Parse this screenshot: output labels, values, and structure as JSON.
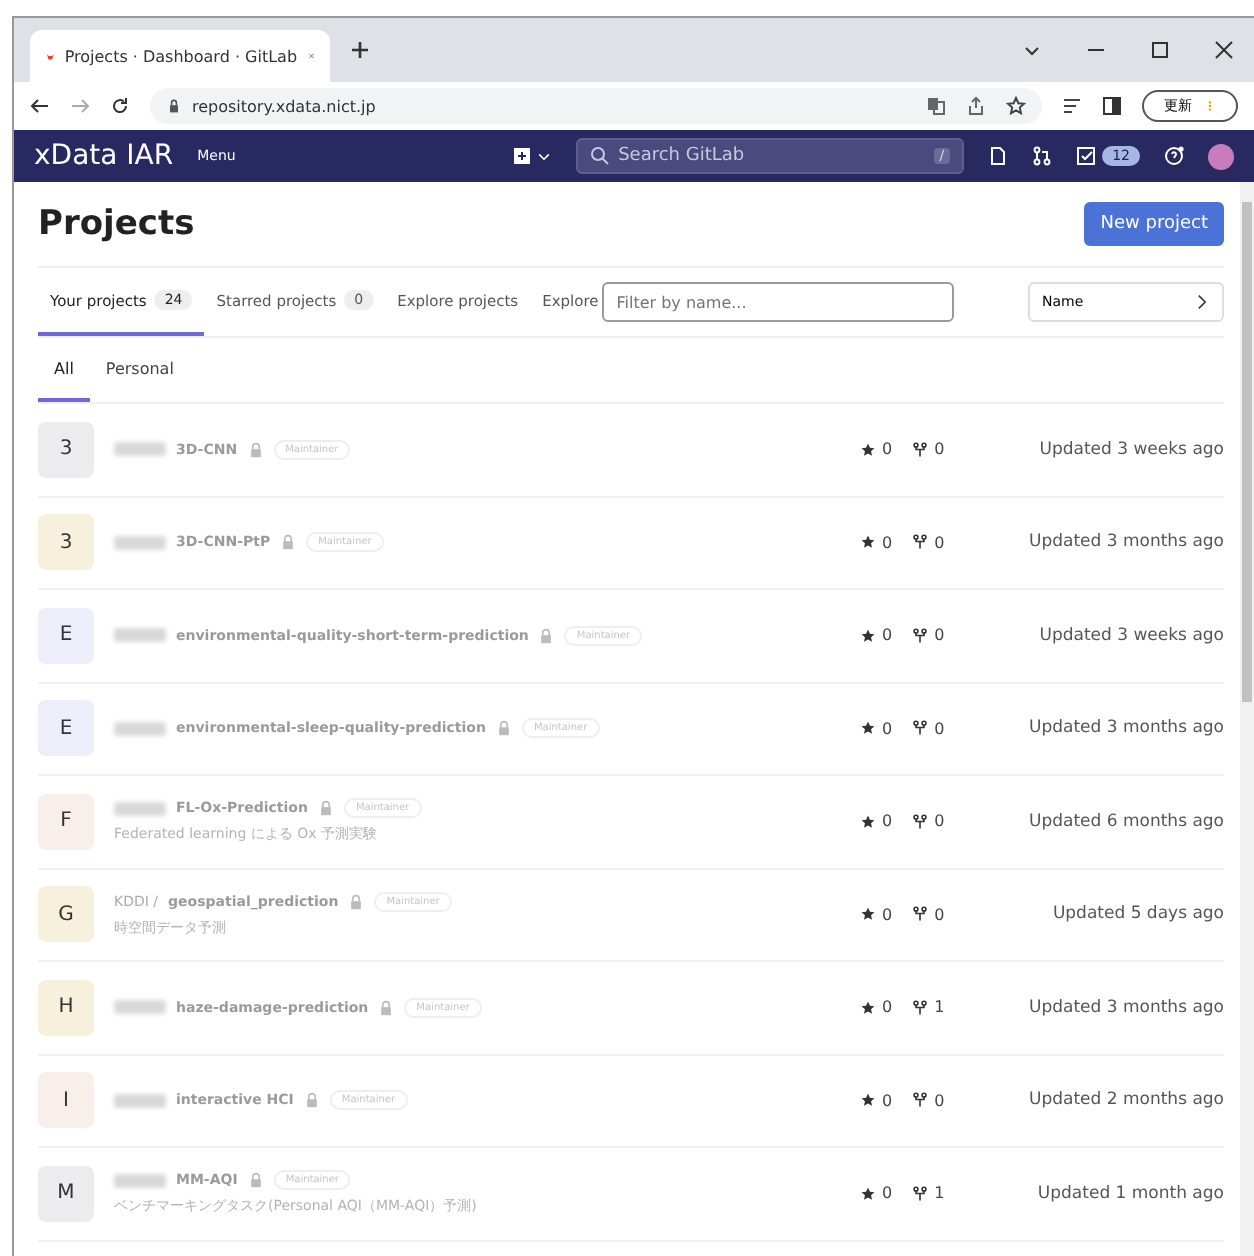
{
  "browser": {
    "tab_title": "Projects · Dashboard · GitLab",
    "url": "repository.xdata.nict.jp",
    "update_button": "更新"
  },
  "nav": {
    "brand": "xData IAR",
    "menu": "Menu",
    "search_placeholder": "Search GitLab",
    "search_key": "/",
    "todo_count": "12"
  },
  "page": {
    "title": "Projects",
    "new_button": "New project",
    "tabs": [
      {
        "label": "Your projects",
        "count": "24",
        "selected": true
      },
      {
        "label": "Starred projects",
        "count": "0",
        "selected": false
      },
      {
        "label": "Explore projects",
        "selected": false
      },
      {
        "label": "Explore",
        "selected": false
      }
    ],
    "filter_placeholder": "Filter by name...",
    "sort": "Name",
    "subtabs": [
      {
        "label": "All",
        "selected": true
      },
      {
        "label": "Personal",
        "selected": false
      }
    ]
  },
  "projects": [
    {
      "avatar": "3",
      "color": "#ececef",
      "name": "3D-CNN",
      "role": "Maintainer",
      "star_count": "0",
      "fork_count": "0",
      "updated": "Updated 3 weeks ago"
    },
    {
      "avatar": "3",
      "color": "#f7f0dc",
      "name": "3D-CNN-PtP",
      "role": "Maintainer",
      "star_count": "0",
      "fork_count": "0",
      "updated": "Updated 3 months ago"
    },
    {
      "avatar": "E",
      "color": "#eeeefb",
      "name": "environmental-quality-short-term-prediction",
      "role": "Maintainer",
      "star_count": "0",
      "fork_count": "0",
      "updated": "Updated 3 weeks ago"
    },
    {
      "avatar": "E",
      "color": "#eeeefb",
      "name": "environmental-sleep-quality-prediction",
      "role": "Maintainer",
      "star_count": "0",
      "fork_count": "0",
      "updated": "Updated 3 months ago"
    },
    {
      "avatar": "F",
      "color": "#f8efeb",
      "name": "FL-Ox-Prediction",
      "description": "Federated learning による Ox 予測実験",
      "role": "Maintainer",
      "star_count": "0",
      "fork_count": "0",
      "updated": "Updated 6 months ago"
    },
    {
      "avatar": "G",
      "namespace": "KDDI /",
      "color": "#f7f0dc",
      "name": "geospatial_prediction",
      "description": "時空間データ予測",
      "role": "Maintainer",
      "star_count": "0",
      "fork_count": "0",
      "updated": "Updated 5 days ago"
    },
    {
      "avatar": "H",
      "color": "#f7f0dc",
      "name": "haze-damage-prediction",
      "role": "Maintainer",
      "star_count": "0",
      "fork_count": "1",
      "updated": "Updated 3 months ago"
    },
    {
      "avatar": "I",
      "color": "#f8efeb",
      "name": "interactive HCI",
      "role": "Maintainer",
      "star_count": "0",
      "fork_count": "0",
      "updated": "Updated 2 months ago"
    },
    {
      "avatar": "M",
      "color": "#ececef",
      "name": "MM-AQI",
      "description": "ベンチマーキングタスク(Personal AQI（MM-AQI）予測)",
      "role": "Maintainer",
      "star_count": "0",
      "fork_count": "1",
      "updated": "Updated 1 month ago"
    }
  ]
}
